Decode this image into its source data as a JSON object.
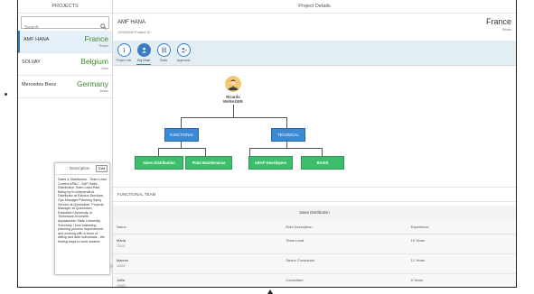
{
  "colors": {
    "accent": "#2f7fbf",
    "tab_bar": "#e3eef4",
    "country_text": "#3d8b2c",
    "blue_node": "#3a8ad6",
    "green_node": "#3bbf6b"
  },
  "master": {
    "title": "PROJECTS",
    "search_placeholder": "Search",
    "projects": [
      {
        "name": "AMF HANA",
        "country": "France",
        "region": "Rhade"
      },
      {
        "name": "SOLVAY",
        "country": "Belgium",
        "region": "Osee"
      },
      {
        "name": "Mercedes Benz",
        "country": "Germany",
        "region": "Munic"
      }
    ]
  },
  "description": {
    "title": "Description",
    "edit_label": "Edit",
    "text": "Sales & Distribution - Team Lead Current APAC - SAP Sales Distribution Team Lead Past Being by In independent Distributor at Filsolux Services, Ops Manager Planning Samy Service at Quicksilver. Projects Manager at Quicksilver, Education University of Tennessee-Knoxville, Appalachian State University Summary I love balancing planning process improvement and working with a team of willing and able individuals - the finding ways to work smarter."
  },
  "detail": {
    "title": "Project Details",
    "object_title": "AMF HANA",
    "object_subtitle": "10034956 Project ID",
    "object_country": "France",
    "object_region": "Rhade",
    "tabs": [
      {
        "label": "Project Info",
        "icon": "info-icon"
      },
      {
        "label": "Org Chart",
        "icon": "person-icon"
      },
      {
        "label": "Tasks",
        "icon": "list-icon"
      },
      {
        "label": "Approvals",
        "icon": "person-check-icon"
      }
    ],
    "org": {
      "manager_name": "Ricardo",
      "manager_role": "MANAGER",
      "teams": [
        "FUNCTIONAL TEAM",
        "TECHNICAL TEAM"
      ],
      "sub_units": [
        "Sales Distribution",
        "Plant Maintenance",
        "ABAP Developers",
        "BASIS"
      ]
    },
    "functional_team_label": "FUNCTIONAL TEAM",
    "sales_header": "Sales Distribution",
    "table": {
      "columns": [
        "Name",
        "Role Description",
        "Experience"
      ],
      "rows": [
        {
          "name": "Maria",
          "id": "10001",
          "role": "Team Lead",
          "exp": "10 Years"
        },
        {
          "name": "Marcos",
          "id": "10002",
          "role": "Senior Consultant",
          "exp": "12 Years"
        },
        {
          "name": "Jullia",
          "id": "10003",
          "role": "Consultant",
          "exp": "8 Years"
        }
      ]
    }
  }
}
